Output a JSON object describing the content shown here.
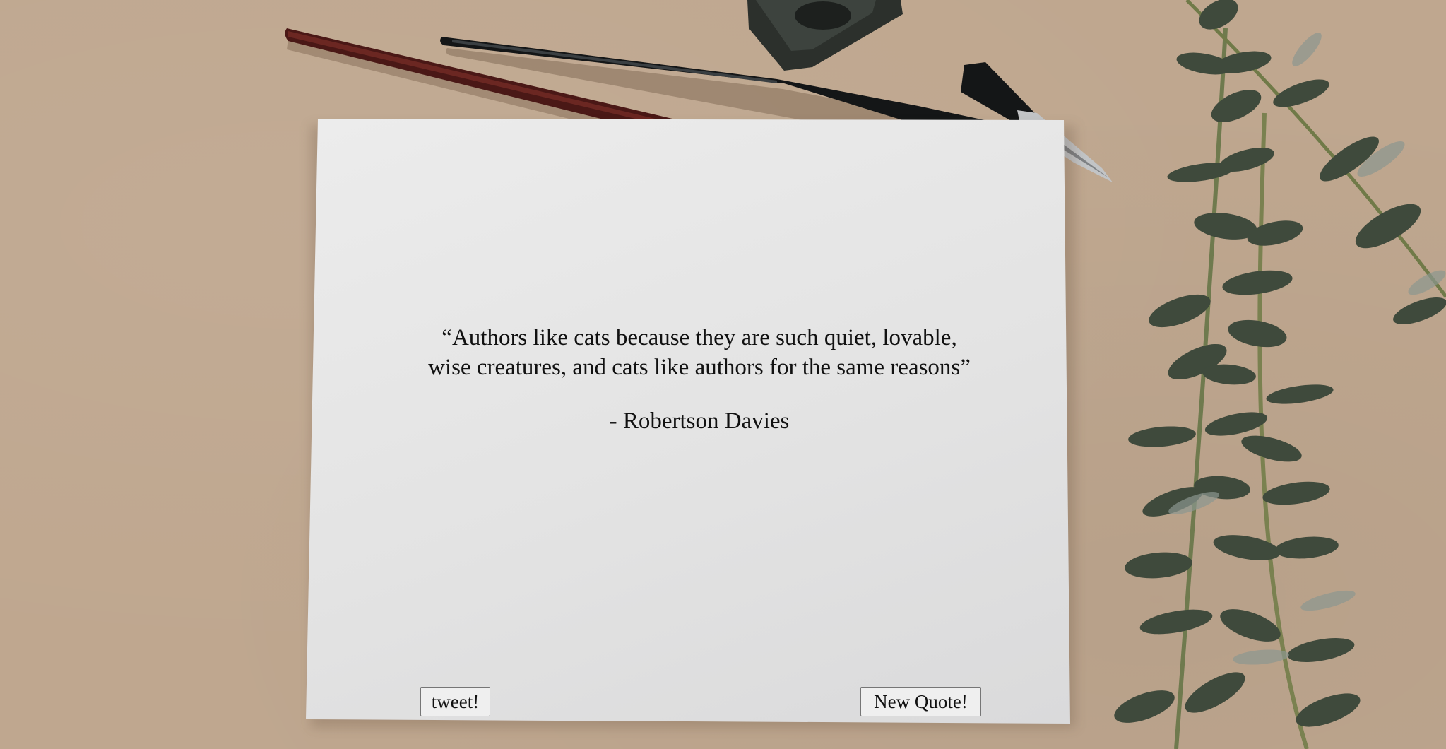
{
  "quote": {
    "text": "“Authors like cats because they are such quiet, lovable, wise creatures, and cats like authors for the same reasons”",
    "author": "- Robertson Davies"
  },
  "buttons": {
    "tweet_label": "tweet!",
    "new_quote_label": "New Quote!"
  },
  "colors": {
    "background": "#bfa78f",
    "paper": "#e5e5e5",
    "text": "#111111",
    "button_bg": "#efefef",
    "button_border": "#767676"
  },
  "background_image": {
    "objects": [
      "ink-bottle",
      "dip-pen-dark-red",
      "dip-pen-black",
      "pen-nib-holder",
      "eucalyptus-branches"
    ]
  }
}
